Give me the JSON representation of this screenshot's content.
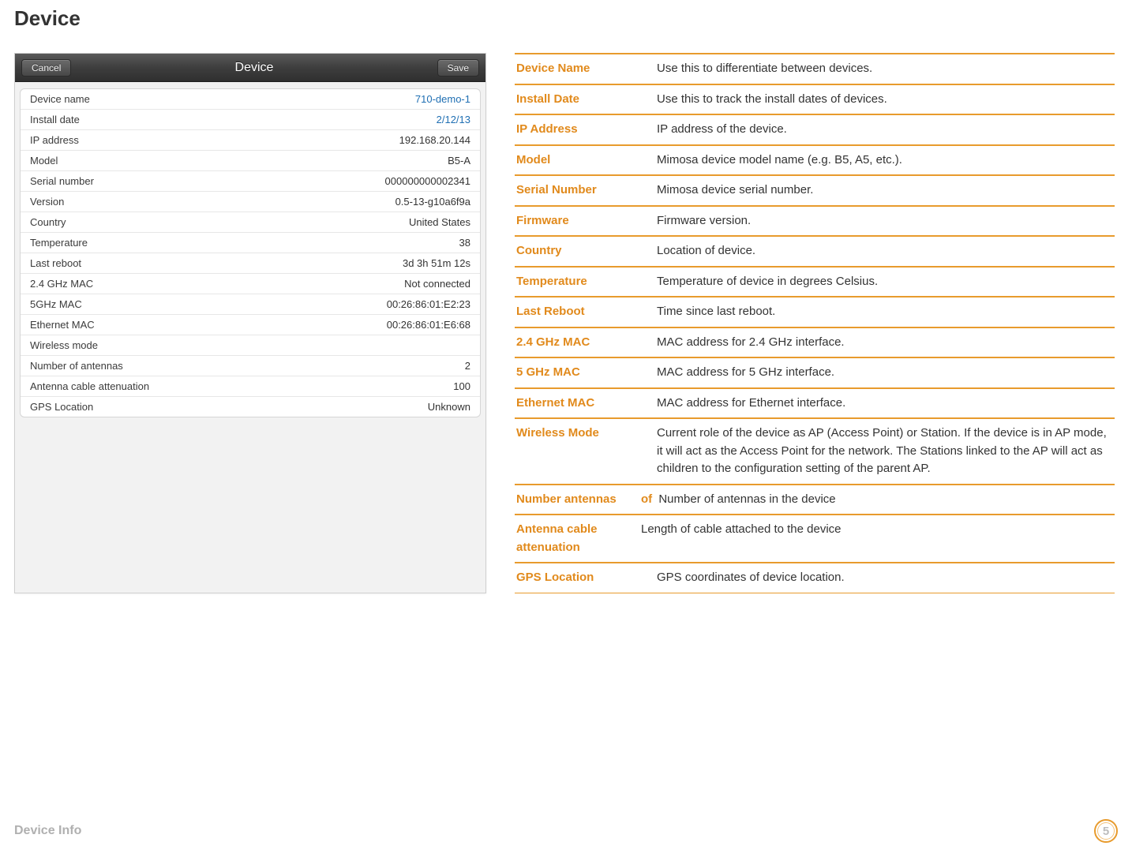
{
  "page_title": "Device",
  "panel": {
    "cancel_label": "Cancel",
    "title": "Device",
    "save_label": "Save",
    "rows": [
      {
        "label": "Device name",
        "value": "710-demo-1",
        "link": true
      },
      {
        "label": "Install date",
        "value": "2/12/13",
        "link": true
      },
      {
        "label": "IP address",
        "value": "192.168.20.144"
      },
      {
        "label": "Model",
        "value": "B5-A"
      },
      {
        "label": "Serial number",
        "value": "000000000002341"
      },
      {
        "label": "Version",
        "value": "0.5-13-g10a6f9a"
      },
      {
        "label": "Country",
        "value": "United States"
      },
      {
        "label": "Temperature",
        "value": "38"
      },
      {
        "label": "Last reboot",
        "value": "3d 3h 51m 12s"
      },
      {
        "label": "2.4 GHz MAC",
        "value": "Not connected"
      },
      {
        "label": "5GHz MAC",
        "value": "00:26:86:01:E2:23"
      },
      {
        "label": "Ethernet MAC",
        "value": "00:26:86:01:E6:68"
      },
      {
        "label": "Wireless mode",
        "value": ""
      },
      {
        "label": "Number of antennas",
        "value": "2"
      },
      {
        "label": "Antenna cable attenuation",
        "value": "100"
      },
      {
        "label": "GPS Location",
        "value": "Unknown"
      }
    ]
  },
  "defs": [
    {
      "term": "Device Name",
      "desc": "Use this to differentiate between devices."
    },
    {
      "term": "Install Date",
      "desc": "Use this to track the install dates of devices."
    },
    {
      "term": "IP Address",
      "desc": "IP address of the device."
    },
    {
      "term": "Model",
      "desc": "Mimosa device model name (e.g. B5, A5, etc.)."
    },
    {
      "term": "Serial Number",
      "desc": "Mimosa device serial number."
    },
    {
      "term": "Firmware",
      "desc": "Firmware version."
    },
    {
      "term": "Country",
      "desc": "Location of device."
    },
    {
      "term": "Temperature",
      "desc": "Temperature of device in degrees Celsius."
    },
    {
      "term": "Last Reboot",
      "desc": "Time since last reboot."
    },
    {
      "term": "2.4 GHz MAC",
      "desc": "MAC address for 2.4 GHz interface."
    },
    {
      "term": "5 GHz MAC",
      "desc": "MAC address for 5 GHz interface."
    },
    {
      "term": "Ethernet MAC",
      "desc": "MAC address for Ethernet interface."
    },
    {
      "term": "Wireless Mode",
      "desc": "Current role of the device as AP (Access Point) or Station. If the device is in AP mode, it will act as the Access Point for the network. The Stations linked to the AP will act as children to the configuration setting of the parent AP."
    },
    {
      "term": "Number antennas",
      "of_inline": "of",
      "desc": "Number of antennas in the device",
      "special": true
    },
    {
      "term": "Antenna cable attenuation",
      "desc": "Length of cable attached to the device",
      "special": true
    },
    {
      "term": "GPS Location",
      "desc": "GPS coordinates of device location."
    }
  ],
  "footer": {
    "label": "Device Info",
    "page_number": "5"
  }
}
